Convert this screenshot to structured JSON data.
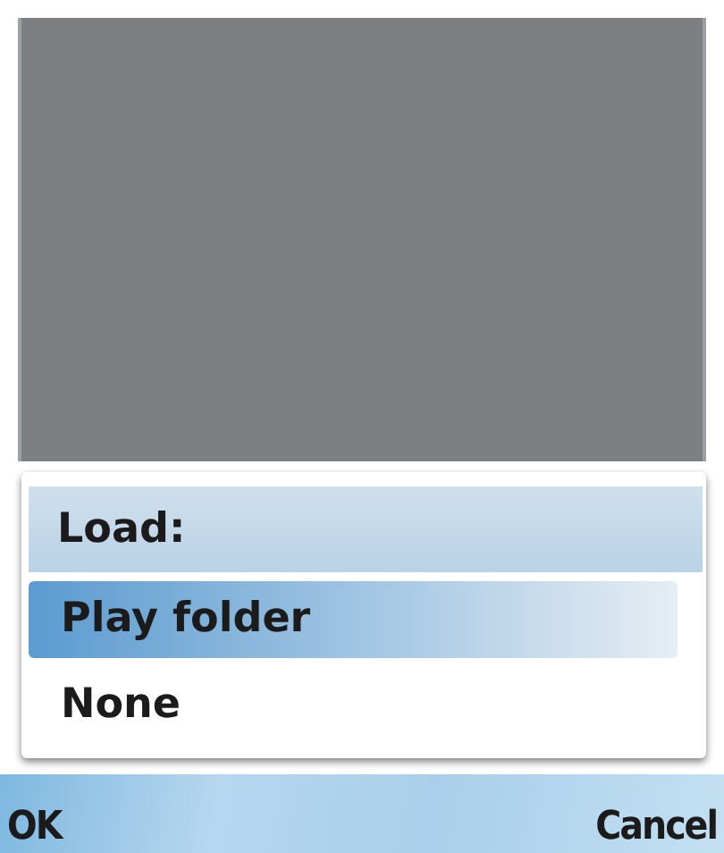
{
  "dialog": {
    "title": "Load:",
    "items": [
      {
        "label": "Play folder",
        "selected": true
      },
      {
        "label": "None",
        "selected": false
      }
    ]
  },
  "softkeys": {
    "left": "OK",
    "right": "Cancel"
  }
}
